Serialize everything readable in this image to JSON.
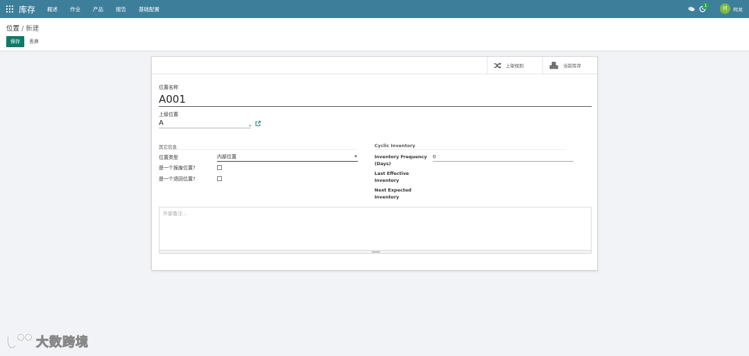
{
  "topbar": {
    "brand": "库存",
    "menu": [
      "概述",
      "作业",
      "产品",
      "报告",
      "基础配置"
    ],
    "activity_count": "1",
    "avatar_char": "何",
    "username": "何龙",
    "color": "#3d7f9b"
  },
  "breadcrumb": {
    "parent": "位置",
    "separator": " / ",
    "current": "新建"
  },
  "buttons": {
    "save": "保存",
    "discard": "丢弃"
  },
  "smart_buttons": {
    "putaway": "上架规则",
    "stock": "当前库存"
  },
  "form": {
    "name_label": "位置名称",
    "name_value": "A001",
    "parent_label": "上级位置",
    "parent_value": "A",
    "section_other": "其它信息",
    "type_label": "位置类型",
    "type_value": "内部位置",
    "scrap_label": "是一个报废位置?",
    "return_label": "是一个退回位置?",
    "section_cyclic": "Cyclic Inventory",
    "freq_label_line1": "Inventory Frequency",
    "freq_label_line2": "(Days)",
    "freq_value": "0",
    "last_label_line1": "Last Effective",
    "last_label_line2": "Inventory",
    "next_label_line1": "Next Expected",
    "next_label_line2": "Inventory",
    "notes_placeholder": "外部备注..."
  },
  "watermark": "大数跨境"
}
